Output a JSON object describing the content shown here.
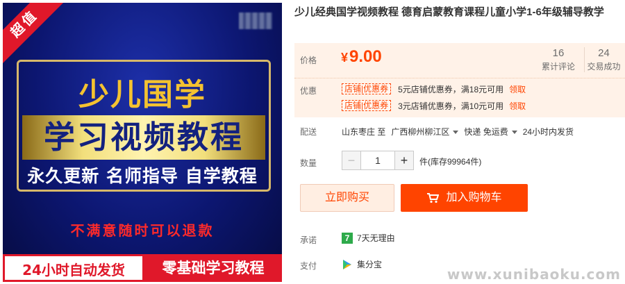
{
  "image": {
    "corner_badge": "超值",
    "title_line1": "少儿国学",
    "title_line2": "学习视频教程",
    "features": "永久更新 名师指导 自学教程",
    "guarantee": "不满意随时可以退款",
    "bottom_left": "24小时自动发货",
    "bottom_right": "零基础学习教程"
  },
  "product": {
    "title": "少儿经典国学视频教程 德育启蒙教育课程儿童小学1-6年级辅导教学"
  },
  "price": {
    "label": "价格",
    "symbol": "¥",
    "value": "9.00",
    "reviews_count": "16",
    "reviews_label": "累计评论",
    "trades_count": "24",
    "trades_label": "交易成功"
  },
  "coupons": {
    "label": "优惠",
    "items": [
      {
        "tag": "店铺|优惠券",
        "text": "5元店铺优惠券，满18元可用",
        "action": "领取"
      },
      {
        "tag": "店铺|优惠券",
        "text": "3元店铺优惠券，满10元可用",
        "action": "领取"
      }
    ]
  },
  "shipping": {
    "label": "配送",
    "from": "山东枣庄 至",
    "to": "广西柳州柳江区",
    "method": "快递 免运费",
    "dispatch": "24小时内发货"
  },
  "quantity": {
    "label": "数量",
    "value": "1",
    "minus": "−",
    "plus": "+",
    "stock": "件(库存99964件)"
  },
  "actions": {
    "buy_now": "立即购买",
    "add_to_cart": "加入购物车"
  },
  "promise": {
    "label": "承诺",
    "icon_text": "7",
    "text": "7天无理由"
  },
  "payment": {
    "label": "支付",
    "text": "集分宝"
  },
  "watermark": "www.xunibaoku.com",
  "colors": {
    "accent": "#ff4400",
    "promo_bg": "#fff2e8",
    "image_blue": "#0c1670",
    "gold": "#f4c230"
  }
}
